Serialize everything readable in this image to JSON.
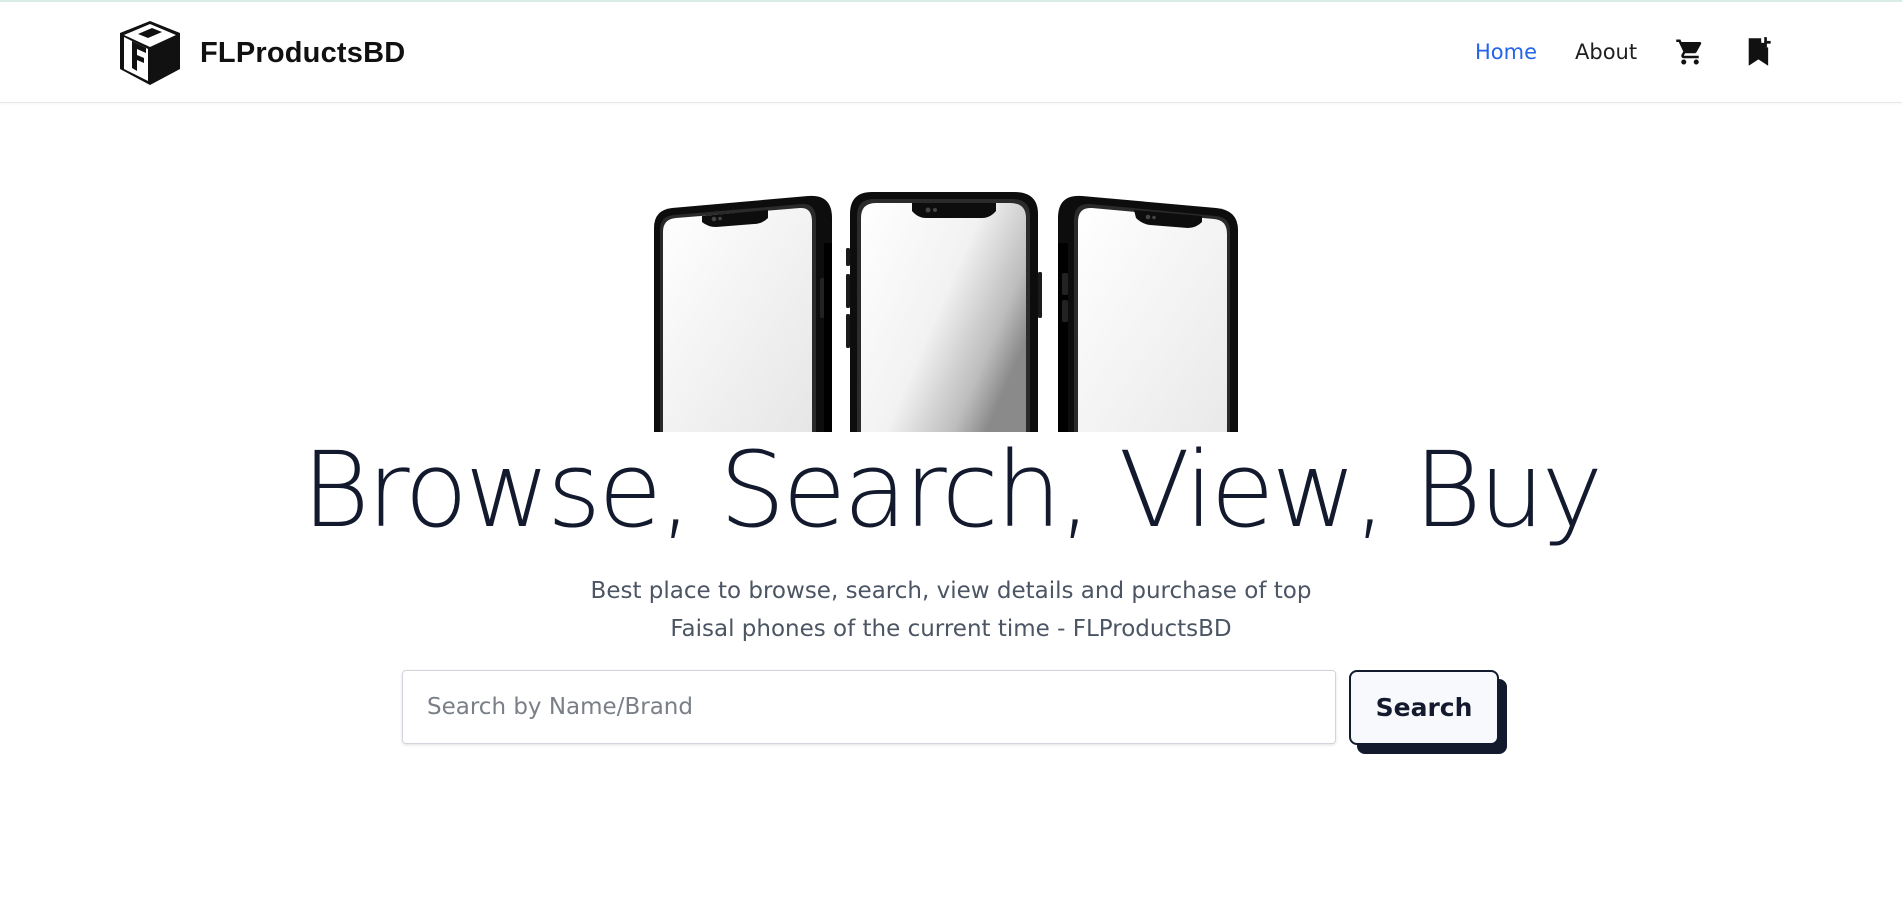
{
  "brand": {
    "name": "FLProductsBD",
    "logo_icon": "fl-cube-logo-icon"
  },
  "nav": {
    "home": "Home",
    "about": "About",
    "cart_icon": "shopping-cart-icon",
    "bookmark_icon": "bookmark-add-icon",
    "active_color": "#2563eb"
  },
  "hero": {
    "image": "three-smartphones-image",
    "title": "Browse, Search, View, Buy",
    "subtitle_line1": "Best place to browse, search, view details and purchase of top",
    "subtitle_line2": "Faisal phones of the current time - FLProductsBD"
  },
  "search": {
    "placeholder": "Search by Name/Brand",
    "value": "",
    "button_label": "Search"
  }
}
